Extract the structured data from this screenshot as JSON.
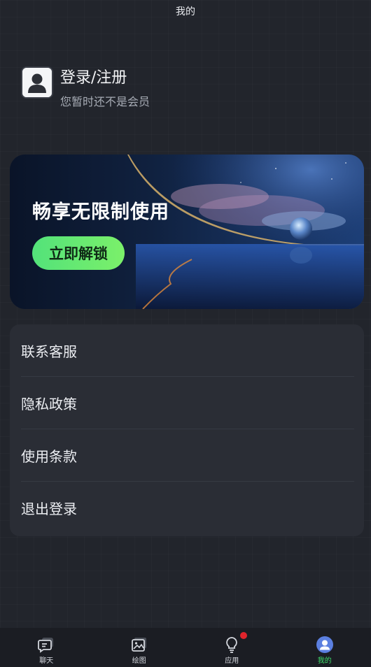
{
  "header": {
    "title": "我的"
  },
  "profile": {
    "name": "登录/注册",
    "subtitle": "您暂时还不是会员",
    "avatar_icon": "user-icon"
  },
  "banner": {
    "title": "畅享无限制使用",
    "button_label": "立即解锁",
    "accent": "#5ae477"
  },
  "menu": {
    "items": [
      {
        "label": "联系客服"
      },
      {
        "label": "隐私政策"
      },
      {
        "label": "使用条款"
      },
      {
        "label": "退出登录"
      }
    ]
  },
  "tabbar": {
    "tabs": [
      {
        "label": "聊天",
        "icon": "chat-icon",
        "active": false
      },
      {
        "label": "绘图",
        "icon": "image-icon",
        "active": false
      },
      {
        "label": "应用",
        "icon": "lightbulb-icon",
        "active": false,
        "badge": true
      },
      {
        "label": "我的",
        "icon": "profile-icon",
        "active": true
      }
    ],
    "active_color": "#3fdc6a",
    "badge_color": "#e0242c"
  }
}
